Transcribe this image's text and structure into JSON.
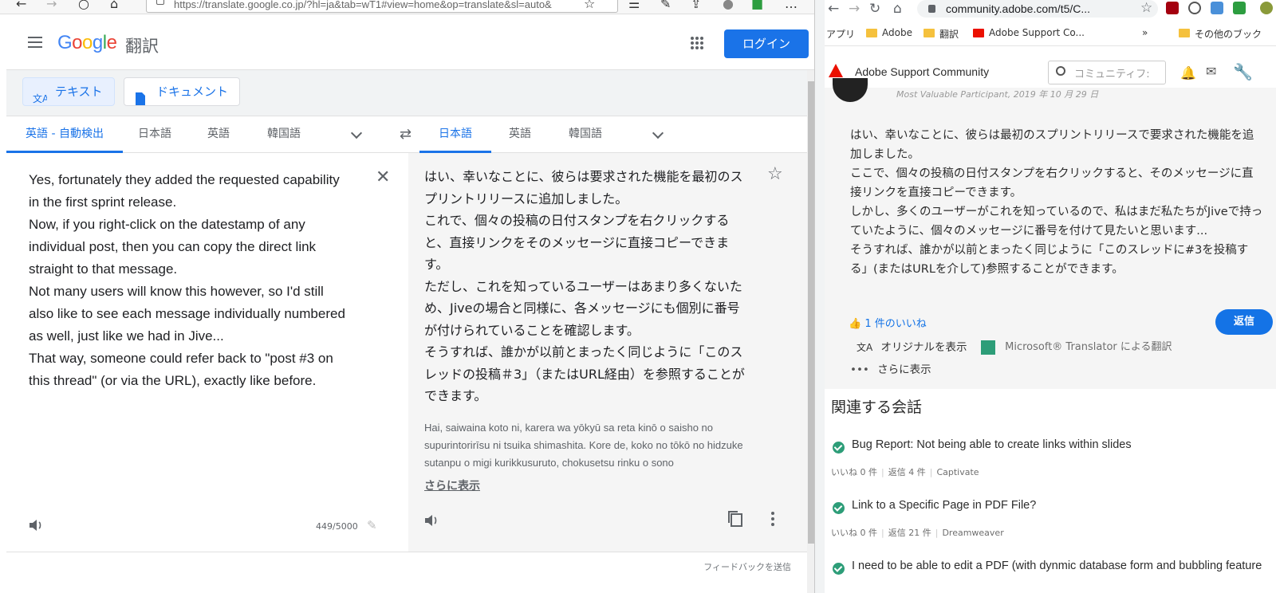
{
  "left_browser": {
    "address": "https://translate.google.co.jp/?hl=ja&tab=wT1#view=home&op=translate&sl=auto&"
  },
  "gt": {
    "logo": {
      "G": "G",
      "o1": "o",
      "o2": "o",
      "g": "g",
      "l": "l",
      "e": "e"
    },
    "product": "翻訳",
    "login": "ログイン",
    "modes": {
      "text": "テキスト",
      "document": "ドキュメント"
    },
    "source_langs": [
      "英語 - 自動検出",
      "日本語",
      "英語",
      "韓国語"
    ],
    "target_langs": [
      "日本語",
      "英語",
      "韓国語"
    ],
    "source_text": "Yes, fortunately they added the requested capability\nin the first sprint release.\nNow, if you right-click on the datestamp of any\nindividual post, then you can copy the direct link\nstraight to that message.\nNot many users will know this however, so I'd still\nalso like to see each message individually numbered\nas well, just like we had in Jive...\nThat way, someone could refer back to \"post #3 on\nthis thread\" (or via the URL), exactly like before.",
    "char_count": "449/5000",
    "target_paragraphs": [
      "はい、幸いなことに、彼らは要求された機能を最初のスプリントリリースに追加しました。",
      "これで、個々の投稿の日付スタンプを右クリックすると、直接リンクをそのメッセージに直接コピーできます。",
      "ただし、これを知っているユーザーはあまり多くないため、Jiveの場合と同様に、各メッセージにも個別に番号が付けられていることを確認します。",
      "そうすれば、誰かが以前とまったく同じように「このスレッドの投稿＃3」（またはURL経由）を参照することができます。"
    ],
    "transliteration": "Hai, saiwaina koto ni, karera wa yōkyū sa reta kinō o saisho no supurintorirīsu ni tsuika shimashita. Kore de, koko no tōkō no hidzuke sutanpu o migi kurikkusuruto, chokusetsu rinku o sono",
    "show_more": "さらに表示",
    "feedback": "フィードバックを送信"
  },
  "right_browser": {
    "address": "community.adobe.com/t5/C...",
    "bookmarks": [
      "アプリ",
      "Adobe",
      "翻訳",
      "Adobe Support Co...",
      "»",
      "その他のブック"
    ]
  },
  "adobe": {
    "title": "Adobe Support Community",
    "search_placeholder": "コミュニティフ:",
    "cut_meta": "Most Valuable Participant, 2019 年 10 月 29 日",
    "post_paragraphs": [
      "はい、幸いなことに、彼らは最初のスプリントリリースで要求された機能を追加しました。",
      "ここで、個々の投稿の日付スタンプを右クリックすると、そのメッセージに直接リンクを直接コピーできます。",
      "しかし、多くのユーザーがこれを知っているので、私はまだ私たちがJiveで持っていたように、個々のメッセージに番号を付けて見たいと思います...",
      "そうすれば、誰かが以前とまったく同じように「このスレッドに#3を投稿する」(またはURLを介して)参照することができます。"
    ],
    "likes": "1 件のいいね",
    "reply": "返信",
    "show_original": "オリジナルを表示",
    "ms_translator": "Microsoft® Translator による翻訳",
    "more": "さらに表示",
    "related_title": "関連する会話",
    "conversations": [
      {
        "title": "Bug Report: Not being able to create links within slides",
        "likes": "いいね 0 件",
        "replies": "返信 4 件",
        "product": "Captivate"
      },
      {
        "title": "Link to a Specific Page in PDF File?",
        "likes": "いいね 0 件",
        "replies": "返信 21 件",
        "product": "Dreamweaver"
      },
      {
        "title": "I need to be able to edit a PDF (with dynmic database form and bubbling feature",
        "likes": "",
        "replies": "",
        "product": ""
      }
    ]
  },
  "colors": {
    "google_blue": "#1a73e8",
    "adobe_red": "#eb1000",
    "adobe_blue": "#1473e6",
    "resolved_green": "#2d9d78"
  }
}
